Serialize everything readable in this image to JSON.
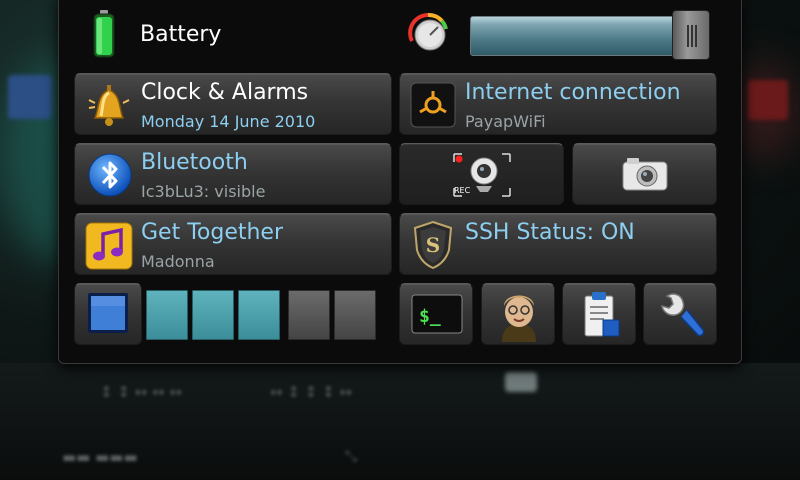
{
  "status": {
    "battery_label": "Battery",
    "volume_level": 0.86,
    "brightness_level": 3,
    "brightness_max": 5
  },
  "tiles": {
    "clock": {
      "title": "Clock & Alarms",
      "subtitle": "Monday 14 June 2010"
    },
    "internet": {
      "title": "Internet connection",
      "subtitle": "PayapWiFi"
    },
    "bluetooth": {
      "title": "Bluetooth",
      "subtitle": "Ic3bLu3: visible"
    },
    "get_together": {
      "title": "Get Together",
      "subtitle": "Madonna"
    },
    "ssh": {
      "title": "SSH Status: ON"
    },
    "webcam": {
      "rec_label": "REC"
    },
    "terminal": {
      "prompt": "$_"
    }
  },
  "colors": {
    "accent_text": "#8dcff0",
    "battery_green": "#2fd24a",
    "slider_teal": "#4d7a88"
  }
}
